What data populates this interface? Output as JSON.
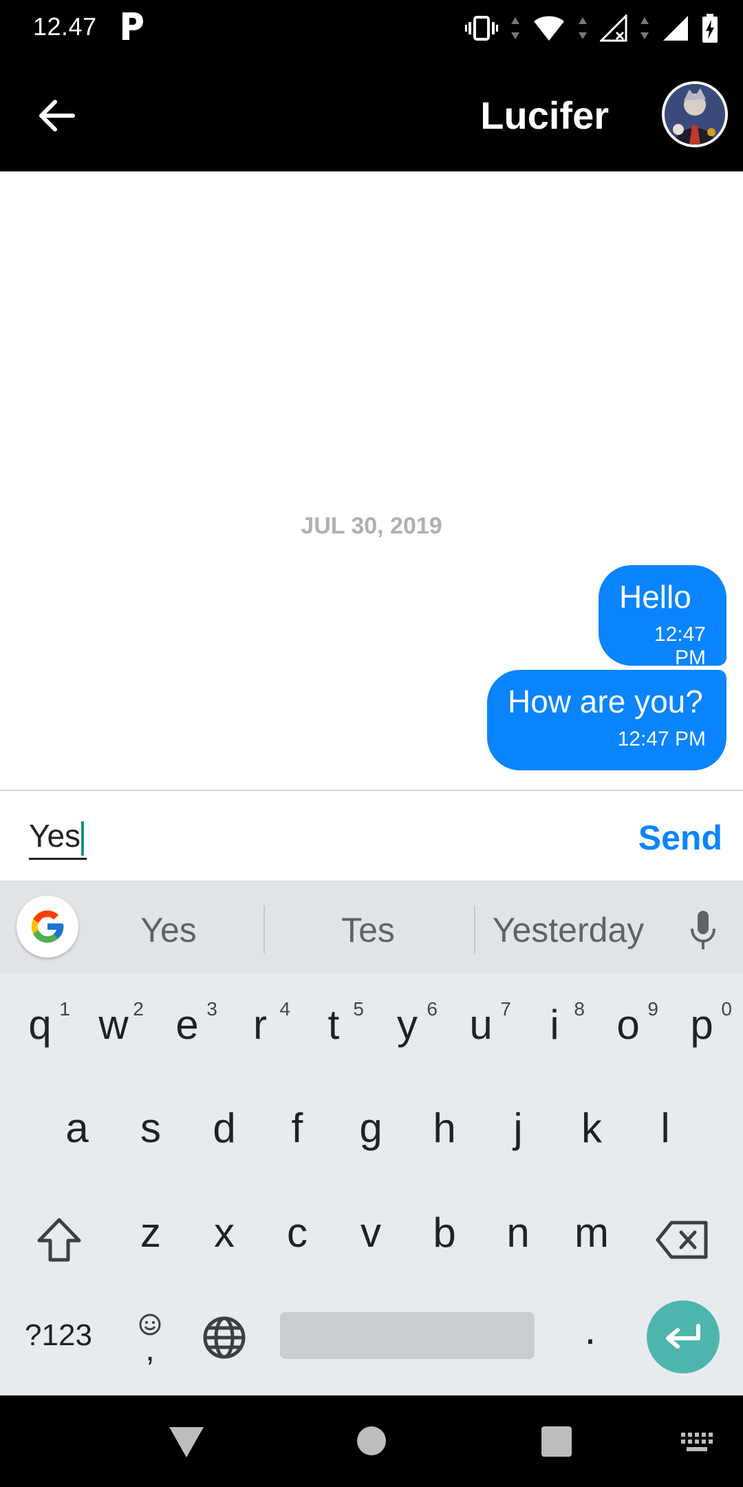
{
  "status_bar": {
    "time": "12.47",
    "icons": [
      "parking-icon",
      "vibrate-icon",
      "wifi-icon",
      "signal-no-sim-icon",
      "signal-icon",
      "battery-charging-icon"
    ]
  },
  "header": {
    "title": "Lucifer",
    "back_icon": "arrow-left-icon"
  },
  "conversation": {
    "date": "JUL 30, 2019",
    "messages": [
      {
        "text": "Hello",
        "time": "12:47 PM"
      },
      {
        "text": "How are you?",
        "time": "12:47 PM"
      }
    ]
  },
  "composer": {
    "value": "Yes",
    "send_label": "Send"
  },
  "keyboard": {
    "suggestions": [
      "Yes",
      "Tes",
      "Yesterday"
    ],
    "row1": [
      {
        "k": "q",
        "n": "1"
      },
      {
        "k": "w",
        "n": "2"
      },
      {
        "k": "e",
        "n": "3"
      },
      {
        "k": "r",
        "n": "4"
      },
      {
        "k": "t",
        "n": "5"
      },
      {
        "k": "y",
        "n": "6"
      },
      {
        "k": "u",
        "n": "7"
      },
      {
        "k": "i",
        "n": "8"
      },
      {
        "k": "o",
        "n": "9"
      },
      {
        "k": "p",
        "n": "0"
      }
    ],
    "row2": [
      "a",
      "s",
      "d",
      "f",
      "g",
      "h",
      "j",
      "k",
      "l"
    ],
    "row3": [
      "z",
      "x",
      "c",
      "v",
      "b",
      "n",
      "m"
    ],
    "symbols_label": "?123",
    "comma_label": ",",
    "period_label": "."
  },
  "colors": {
    "accent": "#0a84ff",
    "enter": "#4db6ac",
    "date_text": "#b0b0b0"
  }
}
